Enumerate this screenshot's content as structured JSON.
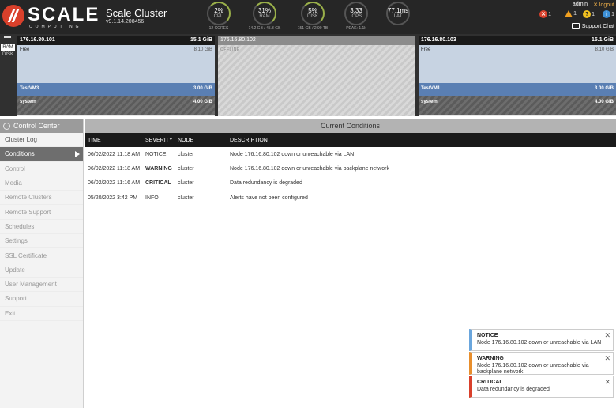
{
  "brand": {
    "word": "SCALE",
    "sub": "COMPUTING"
  },
  "cluster": {
    "name": "Scale Cluster",
    "version": "v9.1.14.208456"
  },
  "gauges": [
    {
      "value": "2%",
      "label": "CPU",
      "sub": "12 CORES"
    },
    {
      "value": "31%",
      "label": "RAM",
      "sub": "14.2 GB / 45.3 GB"
    },
    {
      "value": "5%",
      "label": "DISK",
      "sub": "151 GB / 2.90 TB"
    },
    {
      "value": "3.33",
      "label": "IOPS",
      "sub": "PEAK: 1.1k"
    },
    {
      "value": "77.1ms",
      "label": "LAT",
      "sub": ""
    }
  ],
  "user": {
    "name": "admin",
    "logout": "logout",
    "alerts": {
      "critical": "1",
      "warning": "1",
      "notice": "1",
      "info": "1"
    },
    "support_chat": "Support Chat"
  },
  "resource_toggle": {
    "ram": "RAM",
    "disk": "DISK"
  },
  "nodes": [
    {
      "ip": "176.16.80.101",
      "total": "15.1 GiB",
      "free_label": "Free",
      "free_value": "8.10 GiB",
      "vm_label": "TestVM3",
      "vm_value": "3.00 GiB",
      "sys_label": "system",
      "sys_value": "4.00 GiB"
    },
    {
      "ip": "176.16.80.102",
      "status": "OFFLINE"
    },
    {
      "ip": "176.16.80.103",
      "total": "15.1 GiB",
      "free_label": "Free",
      "free_value": "8.10 GiB",
      "vm_label": "TestVM1",
      "vm_value": "3.00 GiB",
      "sys_label": "system",
      "sys_value": "4.00 GiB"
    }
  ],
  "sidebar": {
    "title": "Control Center",
    "items": [
      "Cluster Log",
      "Conditions",
      "Control",
      "Media",
      "Remote Clusters",
      "Remote Support",
      "Schedules",
      "Settings",
      "SSL Certificate",
      "Update",
      "User Management",
      "Support",
      "Exit"
    ]
  },
  "main": {
    "title": "Current Conditions",
    "columns": [
      "TIME",
      "SEVERITY",
      "NODE",
      "DESCRIPTION"
    ],
    "rows": [
      {
        "time": "06/02/2022 11:18 AM",
        "severity": "NOTICE",
        "node": "cluster",
        "description": "Node 176.16.80.102 down or unreachable via LAN"
      },
      {
        "time": "06/02/2022 11:18 AM",
        "severity": "WARNING",
        "node": "cluster",
        "description": "Node 176.16.80.102 down or unreachable via backplane network"
      },
      {
        "time": "06/02/2022 11:16 AM",
        "severity": "CRITICAL",
        "node": "cluster",
        "description": "Data redundancy is degraded"
      },
      {
        "time": "05/20/2022 3:42 PM",
        "severity": "INFO",
        "node": "cluster",
        "description": "Alerts have not been configured"
      }
    ]
  },
  "toasts": [
    {
      "title": "NOTICE",
      "body": "Node 176.16.80.102 down or unreachable via LAN"
    },
    {
      "title": "WARNING",
      "body": "Node 176.16.80.102 down or unreachable via backplane network"
    },
    {
      "title": "CRITICAL",
      "body": "Data redundancy is degraded"
    }
  ],
  "colors": {
    "brand_red": "#d9402b",
    "header_bg": "#262626",
    "vm_blue": "#5a7fb3",
    "notice": "#f0a020",
    "info": "#3c8fd6"
  }
}
